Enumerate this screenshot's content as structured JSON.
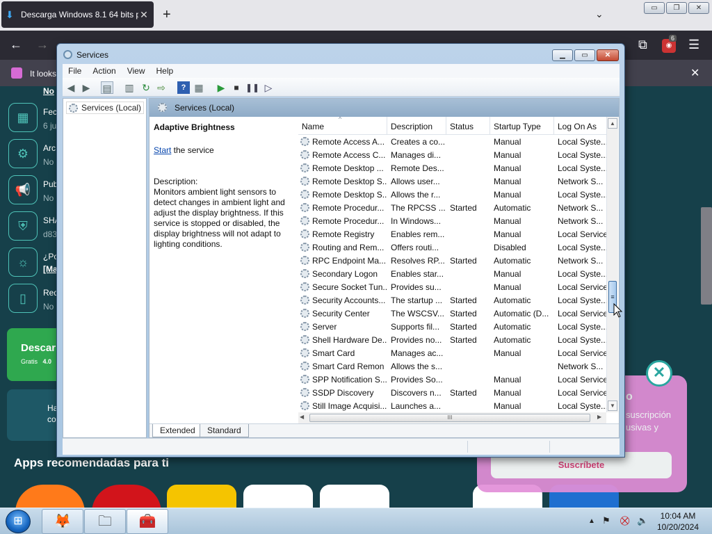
{
  "browser": {
    "tab_title": "Descarga Windows 8.1 64 bits p",
    "tab_close": "✕",
    "new_tab": "+",
    "list_tabs": "⌄",
    "win_min": "▭",
    "win_max": "❐",
    "win_close": "✕",
    "extension_badge": "6",
    "notice_text": "It looks",
    "notice_close": "✕"
  },
  "page": {
    "side_items": [
      {
        "title": "No",
        "sub": ""
      },
      {
        "title": "Fec",
        "sub": "6 ju"
      },
      {
        "title": "Arc",
        "sub": "No"
      },
      {
        "title": "Pub",
        "sub": "No"
      },
      {
        "title": "SHA",
        "sub": "d83"
      },
      {
        "title": "¿Po",
        "sub": "[Ma"
      },
      {
        "title": "Req",
        "sub": "No"
      }
    ],
    "download_btn": "Descar",
    "download_sub": "Gratis",
    "download_ver": "4.0",
    "info_text1": "Ha",
    "info_text2": "co",
    "apps_heading": "Apps recomendadas para ti",
    "promo_title": "o",
    "promo_text1": "suscripción",
    "promo_text2": "usivas y",
    "promo_button": "Suscríbete",
    "promo_close": "✕"
  },
  "services_window": {
    "title": "Services",
    "menu": [
      "File",
      "Action",
      "View",
      "Help"
    ],
    "tree_root": "Services (Local)",
    "pane_header": "Services (Local)",
    "selected_service": "Adaptive Brightness",
    "start_link": "Start",
    "start_suffix": " the service",
    "description_label": "Description:",
    "description_text": "Monitors ambient light sensors to detect changes in ambient light and adjust the display brightness.  If this service is stopped or disabled, the display brightness will not adapt to lighting conditions.",
    "columns": [
      "Name",
      "Description",
      "Status",
      "Startup Type",
      "Log On As"
    ],
    "rows": [
      [
        "Remote Access A...",
        "Creates a co...",
        "",
        "Manual",
        "Local Syste..."
      ],
      [
        "Remote Access C...",
        "Manages di...",
        "",
        "Manual",
        "Local Syste..."
      ],
      [
        "Remote Desktop ...",
        "Remote Des...",
        "",
        "Manual",
        "Local Syste..."
      ],
      [
        "Remote Desktop S...",
        "Allows user...",
        "",
        "Manual",
        "Network S..."
      ],
      [
        "Remote Desktop S...",
        "Allows the r...",
        "",
        "Manual",
        "Local Syste..."
      ],
      [
        "Remote Procedur...",
        "The RPCSS ...",
        "Started",
        "Automatic",
        "Network S..."
      ],
      [
        "Remote Procedur...",
        "In Windows...",
        "",
        "Manual",
        "Network S..."
      ],
      [
        "Remote Registry",
        "Enables rem...",
        "",
        "Manual",
        "Local Service"
      ],
      [
        "Routing and Rem...",
        "Offers routi...",
        "",
        "Disabled",
        "Local Syste..."
      ],
      [
        "RPC Endpoint Ma...",
        "Resolves RP...",
        "Started",
        "Automatic",
        "Network S..."
      ],
      [
        "Secondary Logon",
        "Enables star...",
        "",
        "Manual",
        "Local Syste..."
      ],
      [
        "Secure Socket Tun...",
        "Provides su...",
        "",
        "Manual",
        "Local Service"
      ],
      [
        "Security Accounts...",
        "The startup ...",
        "Started",
        "Automatic",
        "Local Syste..."
      ],
      [
        "Security Center",
        "The WSCSV...",
        "Started",
        "Automatic (D...",
        "Local Service"
      ],
      [
        "Server",
        "Supports fil...",
        "Started",
        "Automatic",
        "Local Syste..."
      ],
      [
        "Shell Hardware De...",
        "Provides no...",
        "Started",
        "Automatic",
        "Local Syste..."
      ],
      [
        "Smart Card",
        "Manages ac...",
        "",
        "Manual",
        "Local Service"
      ],
      [
        "Smart Card Remon",
        "Allows the s...",
        "",
        "",
        "Network S..."
      ],
      [
        "SPP Notification S...",
        "Provides So...",
        "",
        "Manual",
        "Local Service"
      ],
      [
        "SSDP Discovery",
        "Discovers n...",
        "Started",
        "Manual",
        "Local Service"
      ],
      [
        "Still Image Acquisi...",
        "Launches a...",
        "",
        "Manual",
        "Local Syste..."
      ]
    ],
    "tab_extended": "Extended",
    "tab_standard": "Standard"
  },
  "taskbar": {
    "time": "10:04 AM",
    "date": "10/20/2024"
  }
}
